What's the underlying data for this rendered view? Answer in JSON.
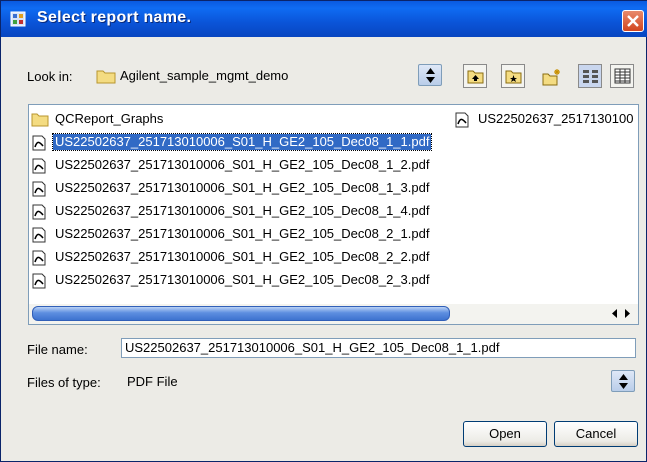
{
  "window": {
    "title": "Select report name."
  },
  "lookin": {
    "label": "Look in:",
    "value": "Agilent_sample_mgmt_demo"
  },
  "toolbar": {
    "buttons": [
      "up-one-level",
      "desktop",
      "new-folder",
      "list-view",
      "details-view"
    ]
  },
  "files": {
    "items": [
      {
        "name": "QCReport_Graphs",
        "type": "folder"
      },
      {
        "name": "US22502637_251713010006_S01_H_GE2_105_Dec08_1_1.pdf",
        "type": "pdf",
        "selected": true
      },
      {
        "name": "US22502637_251713010006_S01_H_GE2_105_Dec08_1_2.pdf",
        "type": "pdf"
      },
      {
        "name": "US22502637_251713010006_S01_H_GE2_105_Dec08_1_3.pdf",
        "type": "pdf"
      },
      {
        "name": "US22502637_251713010006_S01_H_GE2_105_Dec08_1_4.pdf",
        "type": "pdf"
      },
      {
        "name": "US22502637_251713010006_S01_H_GE2_105_Dec08_2_1.pdf",
        "type": "pdf"
      },
      {
        "name": "US22502637_251713010006_S01_H_GE2_105_Dec08_2_2.pdf",
        "type": "pdf"
      },
      {
        "name": "US22502637_251713010006_S01_H_GE2_105_Dec08_2_3.pdf",
        "type": "pdf"
      },
      {
        "name": "US22502637_2517130100",
        "type": "pdf"
      }
    ]
  },
  "filename": {
    "label": "File name:",
    "value": "US22502637_251713010006_S01_H_GE2_105_Dec08_1_1.pdf"
  },
  "filetype": {
    "label": "Files of type:",
    "value": "PDF File"
  },
  "buttons": {
    "open": "Open",
    "cancel": "Cancel"
  },
  "colors": {
    "titlebar": "#0a5ae0",
    "selection": "#316ac5",
    "dialog_bg": "#ecebe6"
  }
}
